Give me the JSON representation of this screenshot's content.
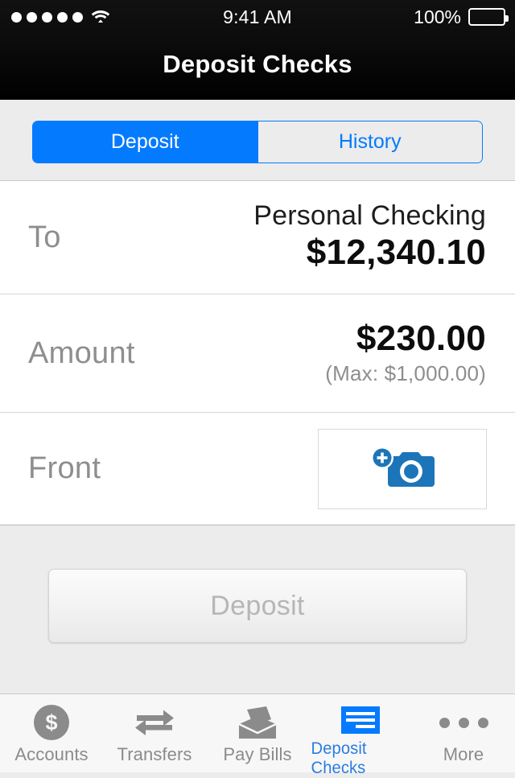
{
  "status_bar": {
    "signal_dots": 5,
    "wifi_icon": "wifi-icon",
    "time": "9:41 AM",
    "battery_percent": "100%",
    "battery_icon": "battery-full-icon"
  },
  "nav": {
    "title": "Deposit Checks"
  },
  "segmented_control": {
    "options": [
      {
        "label": "Deposit",
        "active": true
      },
      {
        "label": "History",
        "active": false
      }
    ],
    "active_color": "#047aff",
    "inactive_bg": "#ececec"
  },
  "form": {
    "to": {
      "label": "To",
      "account_name": "Personal Checking",
      "balance": "$12,340.10"
    },
    "amount": {
      "label": "Amount",
      "value": "$230.00",
      "max_note": "(Max: $1,000.00)"
    },
    "front": {
      "label": "Front",
      "capture_icon": "camera-add-icon",
      "icon_color": "#1c75b8"
    }
  },
  "submit": {
    "label": "Deposit",
    "enabled": false,
    "text_color": "#b6b6b6"
  },
  "tab_bar": {
    "items": [
      {
        "label": "Accounts",
        "icon": "dollar-coin-icon",
        "active": false
      },
      {
        "label": "Transfers",
        "icon": "transfer-arrows-icon",
        "active": false
      },
      {
        "label": "Pay Bills",
        "icon": "envelope-icon",
        "active": false
      },
      {
        "label": "Deposit Checks",
        "icon": "check-icon",
        "active": true
      },
      {
        "label": "More",
        "icon": "ellipsis-icon",
        "active": false
      }
    ],
    "active_color": "#2a7de1",
    "inactive_color": "#8b8b8b"
  }
}
